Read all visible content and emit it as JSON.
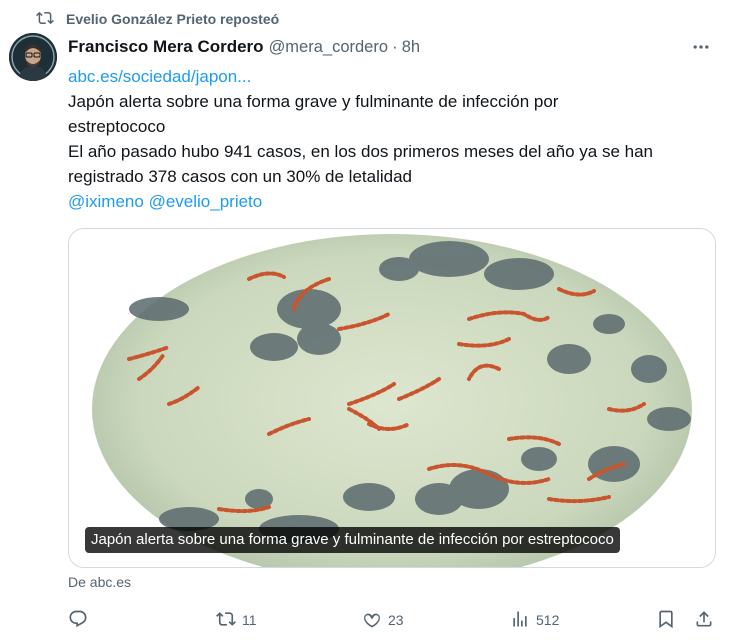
{
  "repost": {
    "text": "Evelio González Prieto reposteó"
  },
  "post": {
    "author_name": "Francisco Mera Cordero",
    "handle": "@mera_cordero",
    "separator": "·",
    "time": "8h",
    "link": "abc.es/sociedad/japon...",
    "lines": [
      "Japón alerta sobre una forma grave y fulminante de infección por",
      "estreptococo",
      "El año pasado hubo 941 casos, en los dos primeros meses del año ya se han",
      "registrado 378 casos con un 30% de letalidad"
    ],
    "mentions": [
      "@iximeno",
      "@evelio_prieto"
    ]
  },
  "card": {
    "caption": "Japón alerta sobre una forma grave y fulminante de infección por estreptococo",
    "source": "De abc.es"
  },
  "actions": {
    "reply": "",
    "reposts": "11",
    "likes": "23",
    "views": "512"
  },
  "colors": {
    "link": "#1d9bf0",
    "secondary": "#536471",
    "border": "#cfd9de",
    "bacteria": "#c8552e",
    "petri_bg": "#cfdcc2"
  },
  "icons": {
    "repost": "repost-icon",
    "more": "more-icon",
    "reply": "reply-icon",
    "like": "heart-icon",
    "views": "views-icon",
    "bookmark": "bookmark-icon",
    "share": "share-icon"
  }
}
